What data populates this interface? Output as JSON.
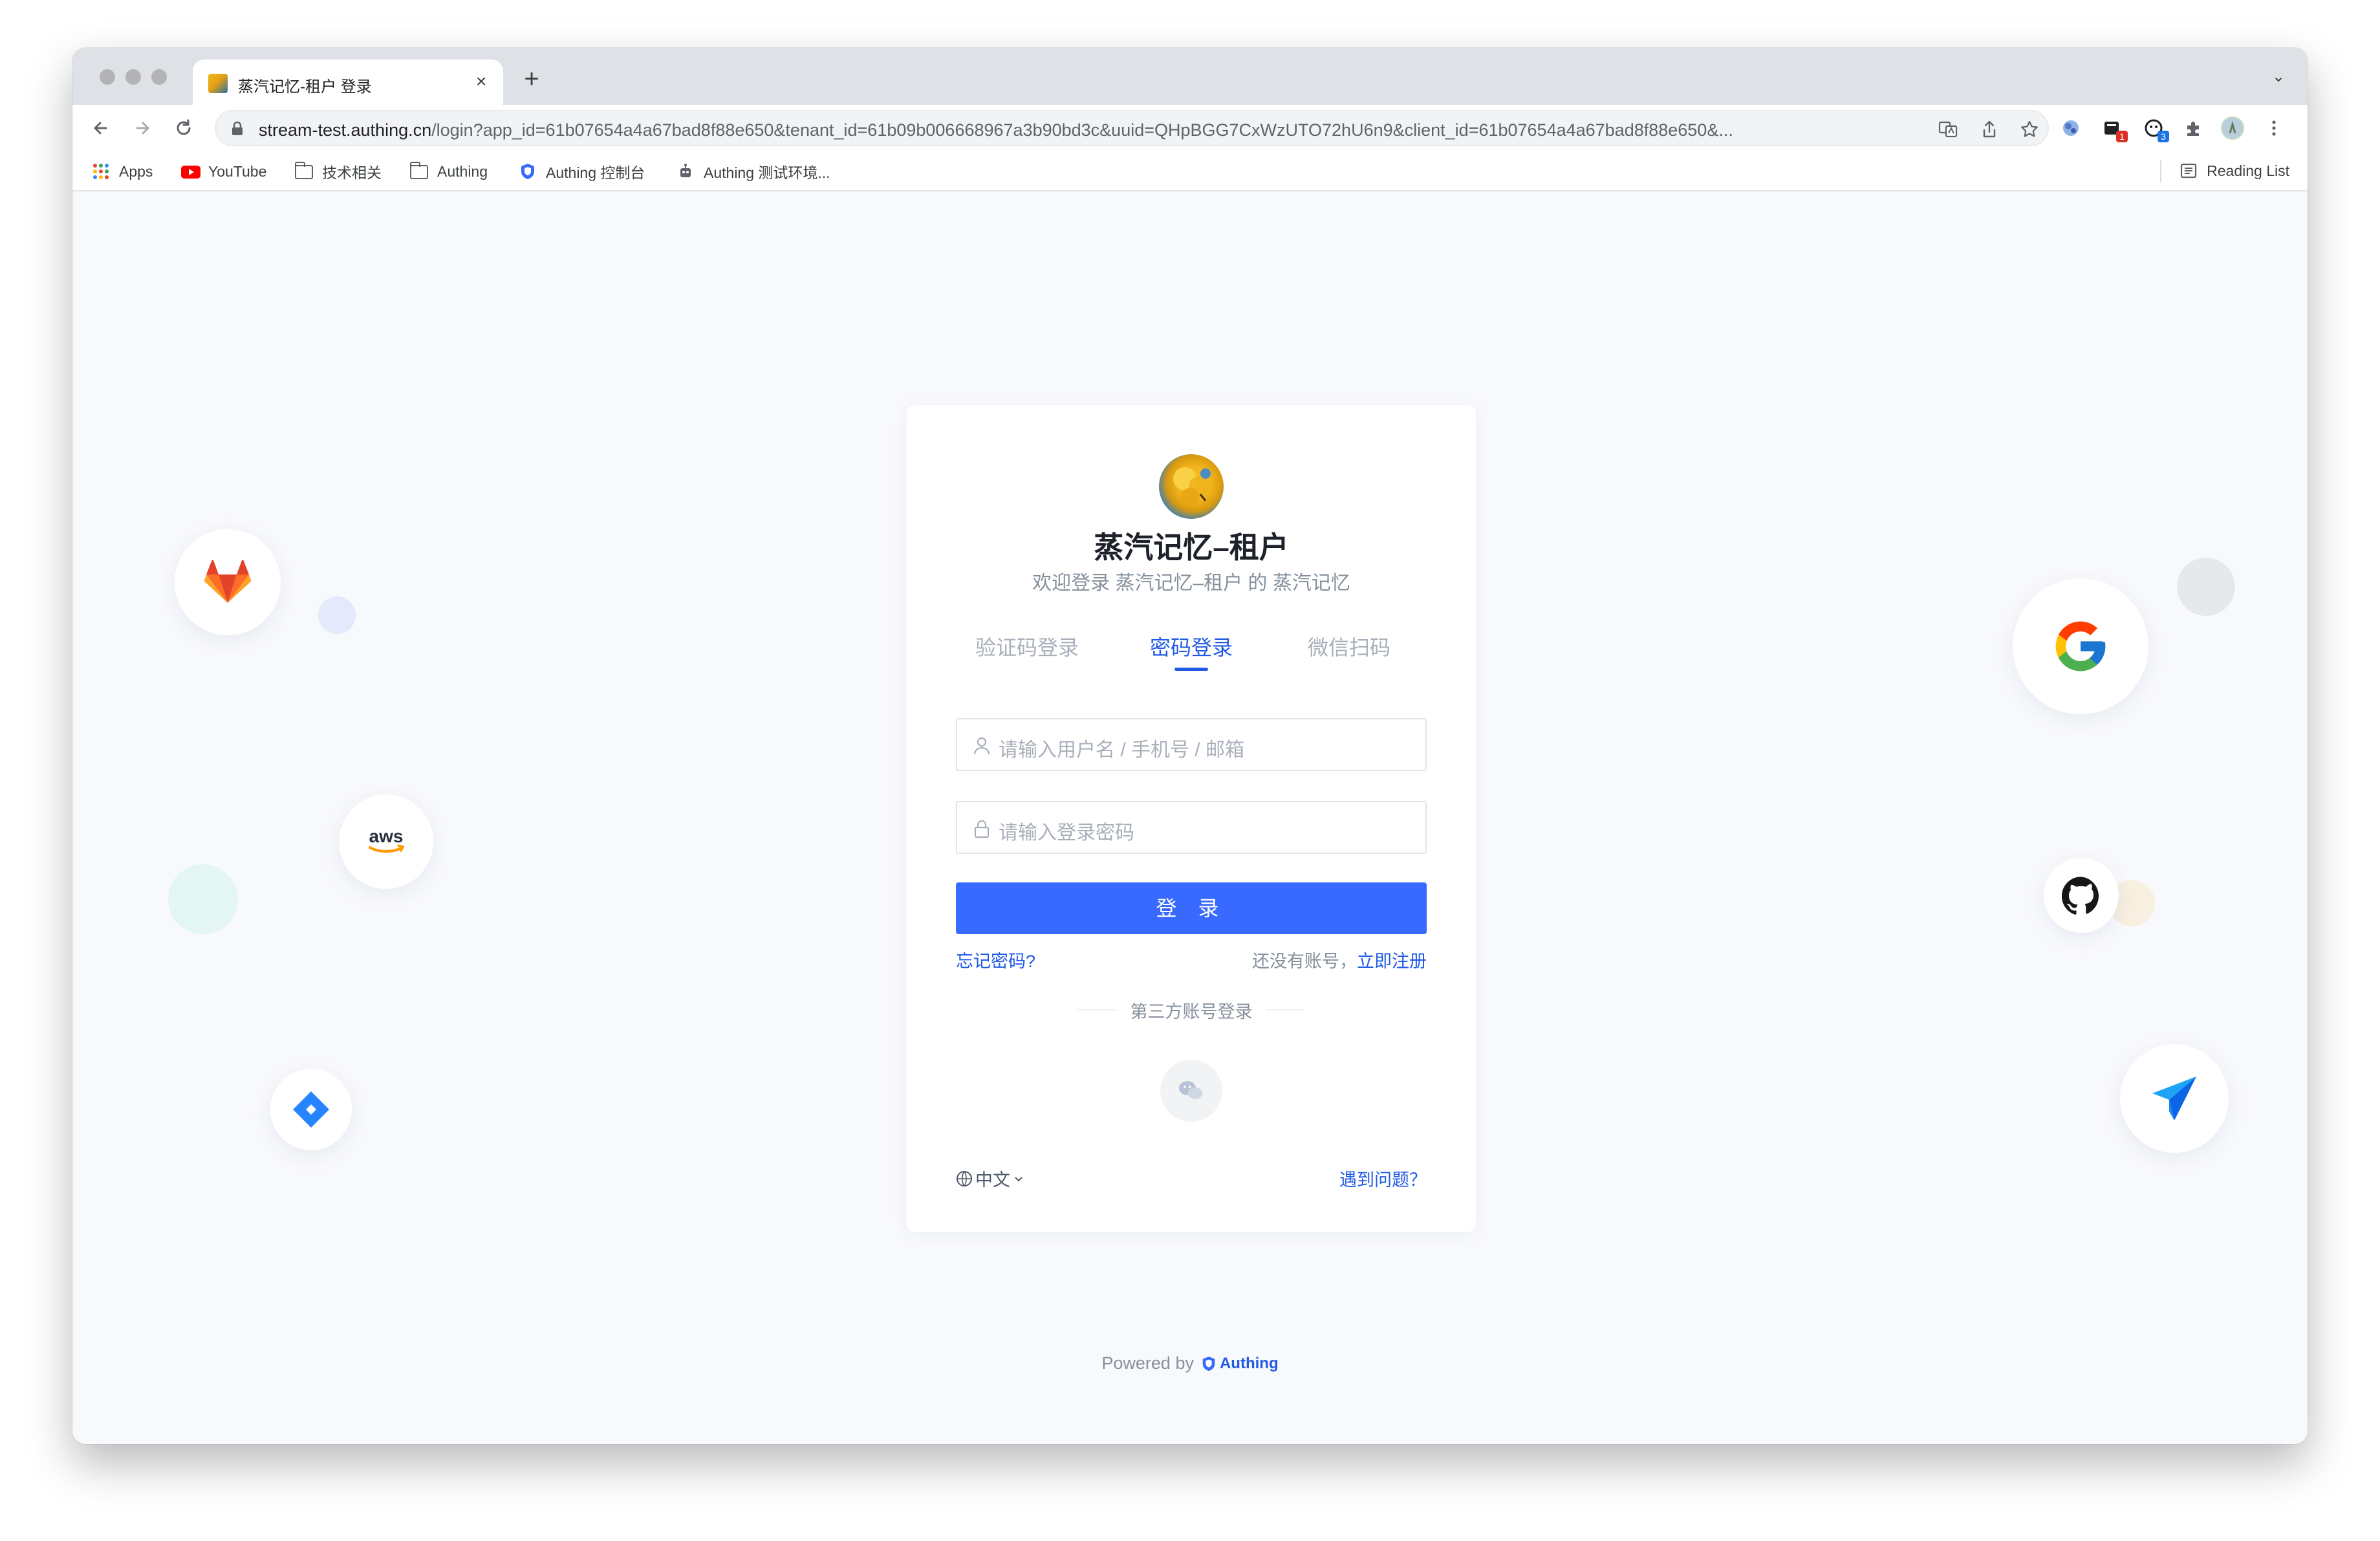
{
  "browser": {
    "tab_title": "蒸汽记忆-租户 登录",
    "tab_close": "×",
    "new_tab": "+",
    "tab_menu": "⌄",
    "url_host": "stream-test.authing.cn",
    "url_rest": "/login?app_id=61b07654a4a67bad8f88e650&tenant_id=61b09b006668967a3b90bd3c&uuid=QHpBGG7CxWzUTO72hU6n9&client_id=61b07654a4a67bad8f88e650&...",
    "ext_badges": [
      "1",
      "3"
    ],
    "bookmarks": [
      "Apps",
      "YouTube",
      "技术相关",
      "Authing",
      "Authing 控制台",
      "Authing 测试环境..."
    ],
    "reading_list": "Reading List"
  },
  "login": {
    "app_name": "蒸汽记忆–租户",
    "welcome": "欢迎登录 蒸汽记忆–租户 的 蒸汽记忆",
    "tabs": [
      {
        "label": "验证码登录",
        "active": false
      },
      {
        "label": "密码登录",
        "active": true
      },
      {
        "label": "微信扫码",
        "active": false
      }
    ],
    "username_placeholder": "请输入用户名 / 手机号 / 邮箱",
    "password_placeholder": "请输入登录密码",
    "submit_label": "登 录",
    "forgot_label": "忘记密码?",
    "no_account_text": "还没有账号，",
    "register_label": "立即注册",
    "third_party_label": "第三方账号登录",
    "language": "中文",
    "help_label": "遇到问题？"
  },
  "footer": {
    "powered_by": "Powered by",
    "brand": "Authing"
  },
  "decor_icons": [
    "gitlab-icon",
    "aws-icon",
    "jira-icon",
    "google-icon",
    "github-icon",
    "paper-plane-icon"
  ],
  "colors": {
    "accent": "#396aff",
    "link": "#215ae5",
    "page_bg": "#f8f9fc",
    "muted_text": "#86909c"
  }
}
